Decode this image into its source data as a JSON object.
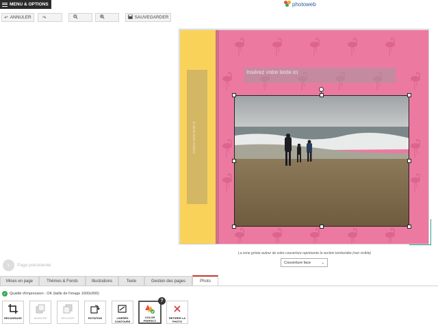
{
  "header": {
    "menu_label": "MENU & OPTIONS",
    "logo_text": "photoweb"
  },
  "toolbar": {
    "undo_label": "ANNULER",
    "redo_label": "",
    "zoom_out_label": "",
    "zoom_in_label": "",
    "save_label": "SAUVEGARDER"
  },
  "editor": {
    "title_placeholder": "Insérez votre texte ici",
    "spine_placeholder": "Insérez votre texte ici",
    "note": "La zone grisée autour de votre couverture représente la section tombordée (non visible)",
    "face_select": "Couverture face"
  },
  "navigation": {
    "prev_page": "Page précédente"
  },
  "tabs": [
    {
      "label": "Mises en page"
    },
    {
      "label": "Thèmes & Fonds"
    },
    {
      "label": "Illustrations"
    },
    {
      "label": "Texte"
    },
    {
      "label": "Gestion des pages"
    },
    {
      "label": "Photo"
    }
  ],
  "photo_panel": {
    "quality": "Qualité d'impression : OK (taille de l'image 1600x900)",
    "tools": [
      {
        "label": "RECADRAGE",
        "icon": "crop-icon"
      },
      {
        "label": "AVANCER",
        "icon": "bring-forward-icon"
      },
      {
        "label": "RECULER",
        "icon": "send-backward-icon"
      },
      {
        "label": "ROTATION",
        "icon": "rotate-icon"
      },
      {
        "label": "LISERÉS CONTOURS",
        "icon": "border-edit-icon"
      },
      {
        "label": "COLOR PERFECT",
        "icon": "color-perfect-icon"
      },
      {
        "label": "RETIRER LA PHOTO",
        "icon": "remove-photo-icon"
      }
    ],
    "help_badge": "?"
  },
  "colors": {
    "cover_pink": "#ec7aa0",
    "spine_yellow": "#f9d25a",
    "active_tab_accent": "#c0392b",
    "ok_green": "#3aa655"
  }
}
